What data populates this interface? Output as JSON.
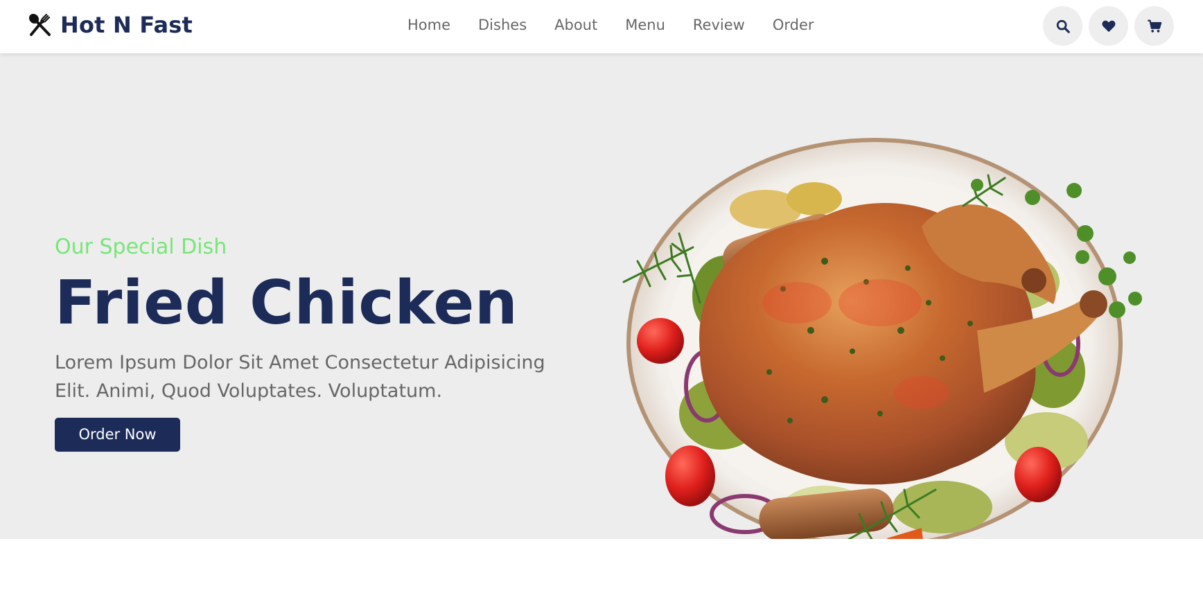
{
  "header": {
    "brand": "Hot N Fast",
    "logo_icon": "utensils-icon",
    "nav": [
      {
        "label": "Home"
      },
      {
        "label": "Dishes"
      },
      {
        "label": "About"
      },
      {
        "label": "Menu"
      },
      {
        "label": "Review"
      },
      {
        "label": "Order"
      }
    ],
    "actions": [
      {
        "icon": "search-icon"
      },
      {
        "icon": "heart-icon"
      },
      {
        "icon": "cart-icon"
      }
    ]
  },
  "hero": {
    "subtitle": "Our Special Dish",
    "title": "Fried Chicken",
    "description": "Lorem Ipsum Dolor Sit Amet Consectetur Adipisicing Elit. Animi, Quod Voluptates. Voluptatum.",
    "cta_label": "Order Now",
    "image": "roast-chicken-plate"
  },
  "colors": {
    "brand_navy": "#1c2b58",
    "accent_green": "#77e677",
    "hero_background": "#ededed",
    "muted_text": "#666666"
  }
}
